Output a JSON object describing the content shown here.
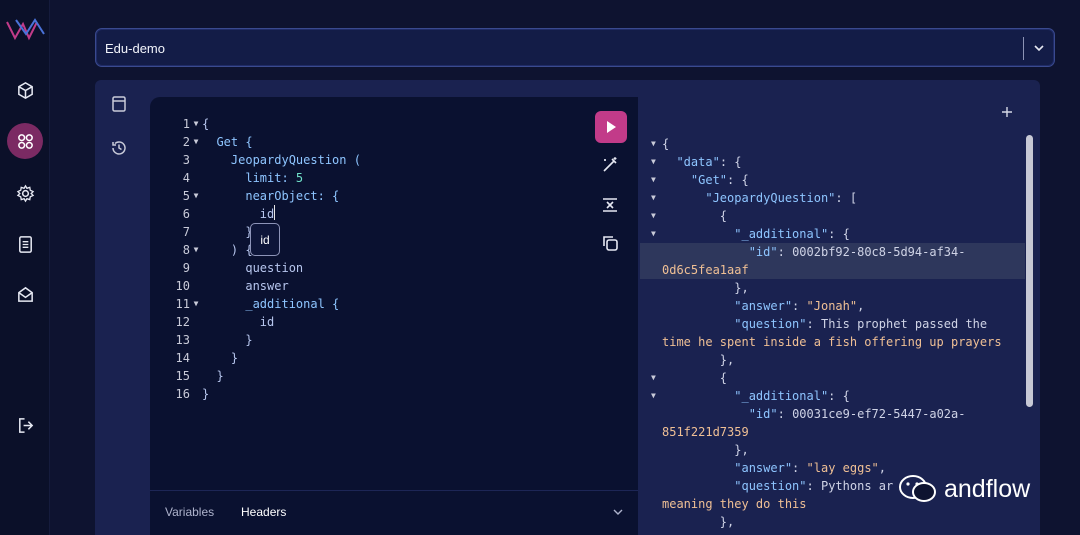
{
  "app": {
    "dataset_selector": {
      "value": "Edu-demo"
    }
  },
  "rail": {
    "items": [
      {
        "icon": "logo-icon"
      },
      {
        "icon": "cube-icon"
      },
      {
        "icon": "grid-icon",
        "active": true
      },
      {
        "icon": "gear-icon"
      },
      {
        "icon": "document-icon"
      },
      {
        "icon": "mail-icon"
      },
      {
        "icon": "logout-icon"
      }
    ]
  },
  "editor": {
    "lines": [
      {
        "n": "1",
        "fold": "▼",
        "code": "{"
      },
      {
        "n": "2",
        "fold": "▼",
        "code": "  Get {"
      },
      {
        "n": "3",
        "fold": "",
        "code": "    JeopardyQuestion ("
      },
      {
        "n": "4",
        "fold": "",
        "code": "      limit: 5"
      },
      {
        "n": "5",
        "fold": "▼",
        "code": "      nearObject: {"
      },
      {
        "n": "6",
        "fold": "",
        "code": "        id"
      },
      {
        "n": "7",
        "fold": "",
        "code": "      }"
      },
      {
        "n": "8",
        "fold": "▼",
        "code": "    ) {"
      },
      {
        "n": "9",
        "fold": "",
        "code": "      question"
      },
      {
        "n": "10",
        "fold": "",
        "code": "      answer"
      },
      {
        "n": "11",
        "fold": "▼",
        "code": "      _additional {"
      },
      {
        "n": "12",
        "fold": "",
        "code": "        id"
      },
      {
        "n": "13",
        "fold": "",
        "code": "      }"
      },
      {
        "n": "14",
        "fold": "",
        "code": "    }"
      },
      {
        "n": "15",
        "fold": "",
        "code": "  }"
      },
      {
        "n": "16",
        "fold": "",
        "code": "}"
      }
    ],
    "autocomplete_item": "id",
    "footer": {
      "variables_label": "Variables",
      "headers_label": "Headers"
    }
  },
  "result": {
    "lines": [
      {
        "fold": "▼",
        "text": "{"
      },
      {
        "fold": "▼",
        "text": "  \"data\": {"
      },
      {
        "fold": "▼",
        "text": "    \"Get\": {"
      },
      {
        "fold": "▼",
        "text": "      \"JeopardyQuestion\": ["
      },
      {
        "fold": "▼",
        "text": "        {"
      },
      {
        "fold": "▼",
        "text": "          \"_additional\": {"
      },
      {
        "fold": "",
        "text": "            \"id\": \"0002bf92-80c8-5d94-af34-"
      },
      {
        "fold": "",
        "text": "0d6c5fea1aaf\""
      },
      {
        "fold": "",
        "text": "          },"
      },
      {
        "fold": "",
        "text": "          \"answer\": \"Jonah\","
      },
      {
        "fold": "",
        "text": "          \"question\": \"This prophet passed the"
      },
      {
        "fold": "",
        "text": "time he spent inside a fish offering up prayers\""
      },
      {
        "fold": "",
        "text": "        },"
      },
      {
        "fold": "▼",
        "text": "        {"
      },
      {
        "fold": "▼",
        "text": "          \"_additional\": {"
      },
      {
        "fold": "",
        "text": "            \"id\": \"00031ce9-ef72-5447-a02a-"
      },
      {
        "fold": "",
        "text": "851f221d7359\""
      },
      {
        "fold": "",
        "text": "          },"
      },
      {
        "fold": "",
        "text": "          \"answer\": \"lay eggs\","
      },
      {
        "fold": "",
        "text": "          \"question\": \"Pythons ar"
      },
      {
        "fold": "",
        "text": "meaning they do this\""
      },
      {
        "fold": "",
        "text": "        },"
      }
    ]
  },
  "watermark": {
    "text": "andflow"
  }
}
